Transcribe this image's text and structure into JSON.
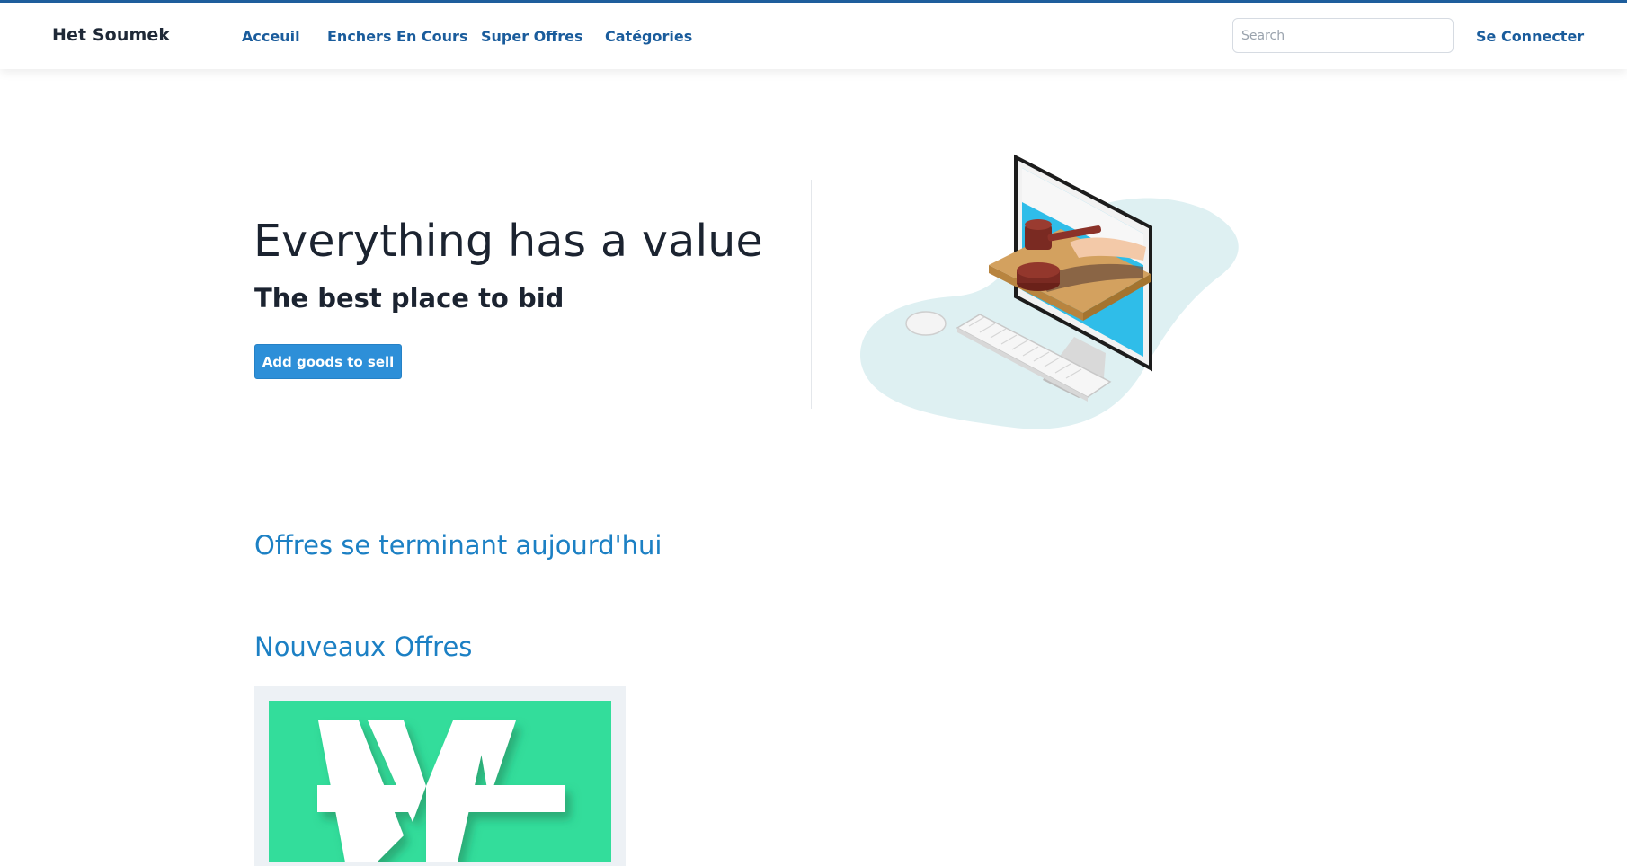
{
  "nav": {
    "brand": "Het Soumek",
    "links": [
      "Acceuil",
      "Enchers En Cours",
      "Super Offres",
      "Catégories"
    ],
    "search_placeholder": "Search",
    "login": "Se Connecter"
  },
  "hero": {
    "title": "Everything has a value",
    "subtitle": "The best place to bid",
    "button": "Add goods to sell"
  },
  "sections": {
    "ending_today": "Offres se terminant aujourd'hui",
    "new_offers": "Nouveaux Offres"
  },
  "colors": {
    "accent": "#2d8fd8",
    "link": "#1a5c9c",
    "heading_blue": "#1c80c4",
    "card_green": "#33dd9b"
  },
  "icons": {
    "hero_illustration": "computer-auction-gavel-illustration",
    "card_logo": "vv-logo"
  }
}
